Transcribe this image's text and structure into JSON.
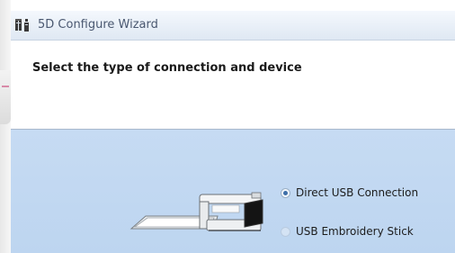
{
  "window": {
    "title": "5D Configure Wizard",
    "title_icon": "wizard-app-icon"
  },
  "header": {
    "heading": "Select the type of connection and device"
  },
  "connection": {
    "options": [
      {
        "label": "Direct USB Connection",
        "selected": true
      },
      {
        "label": "USB Embroidery Stick",
        "selected": false
      }
    ],
    "device_image": "embroidery-machine-image"
  },
  "colors": {
    "content_background": "#c6dbf3",
    "titlebar": "#e6edf6",
    "radio_accent": "#3d6ea8"
  }
}
